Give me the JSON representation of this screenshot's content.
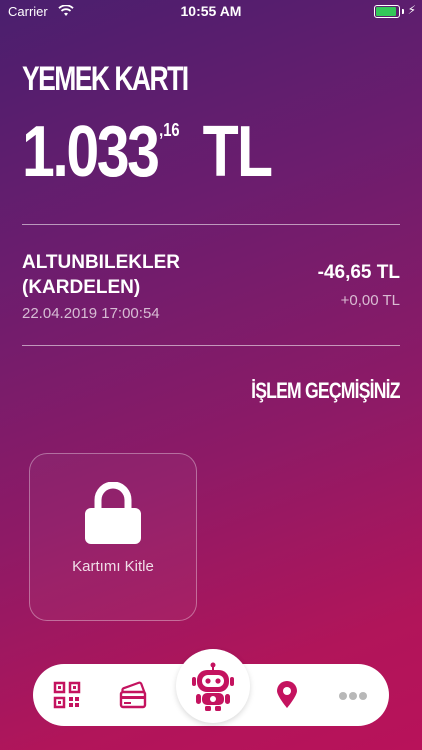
{
  "status_bar": {
    "carrier": "Carrier",
    "time": "10:55 AM"
  },
  "card": {
    "title": "YEMEK KARTI",
    "balance_integer": "1.033",
    "balance_decimal": ",16",
    "currency": "TL"
  },
  "last_transaction": {
    "merchant": "ALTUNBILEKLER (KARDELEN)",
    "datetime": "22.04.2019 17:00:54",
    "amount": "-46,65 TL",
    "secondary_amount": "+0,00 TL"
  },
  "history_link_label": "İŞLEM GEÇMİŞİNİZ",
  "lock_tile": {
    "label": "Kartımı Kitle"
  },
  "bottom_nav": {
    "icons": [
      "qr-code-icon",
      "card-icon",
      "robot-icon",
      "location-pin-icon",
      "more-dots-icon"
    ]
  },
  "colors": {
    "background_top": "#4a1f6e",
    "background_bottom": "#b8125a",
    "accent": "#c4135f",
    "battery": "#34c759"
  }
}
